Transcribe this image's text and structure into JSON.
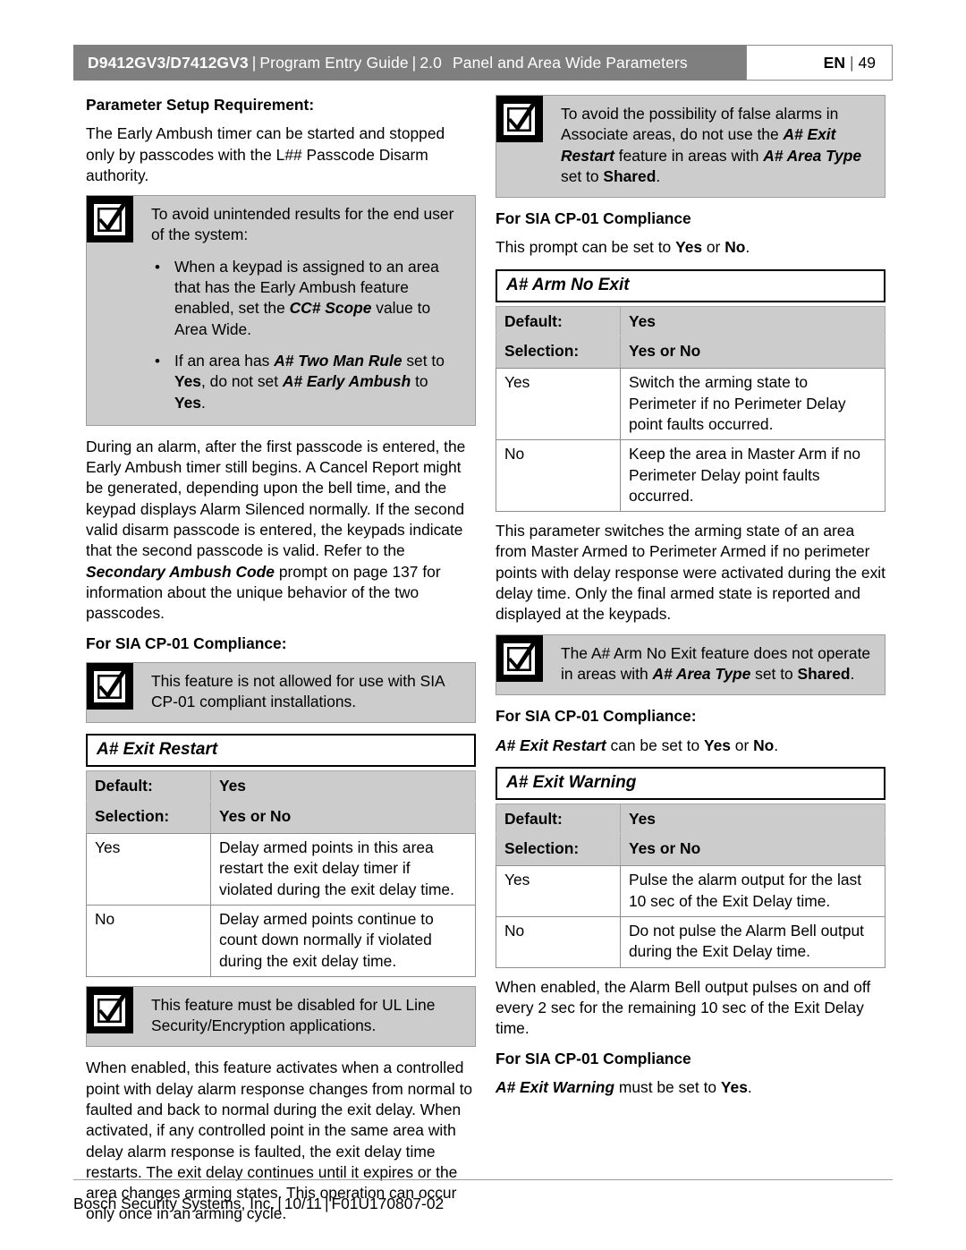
{
  "header": {
    "model": "D9412GV3/D7412GV3",
    "guide": "Program Entry Guide",
    "version": "2.0",
    "section": "Panel and Area Wide Parameters",
    "lang": "EN",
    "page_number": "49",
    "separator": "|"
  },
  "left_column": {
    "setup_heading": "Parameter Setup Requirement:",
    "setup_paragraph": "The Early Ambush timer can be started and stopped only by passcodes with the L## Passcode Disarm authority.",
    "notice_1": {
      "icon": "notice-checkbox-icon",
      "intro": "To avoid unintended results for the end user of the system:",
      "bullets": [
        {
          "part1": "When a keypad is assigned to an area that has the Early Ambush feature enabled, set the ",
          "em1": "CC# Scope",
          "part2": " value to Area Wide."
        },
        {
          "part1": "If an area has ",
          "em1": "A# Two Man Rule",
          "part2": " set to ",
          "b1": "Yes",
          "part3": ", do not set ",
          "em2": "A# Early Ambush",
          "part4": " to ",
          "b2": "Yes",
          "part5": "."
        }
      ]
    },
    "alarm_paragraph_1": "During an alarm, after the first passcode is entered, the Early Ambush timer still begins. A Cancel Report might be generated, depending upon the bell time, and the keypad displays Alarm Silenced normally. If the second valid disarm passcode is entered, the keypads indicate that the second passcode is valid. Refer to the ",
    "alarm_paragraph_em": "Secondary Ambush Code",
    "alarm_paragraph_2": " prompt on page 137 for information about the unique behavior of the two passcodes.",
    "sia_heading": "For SIA CP-01 Compliance:",
    "notice_2": {
      "icon": "notice-checkbox-icon",
      "text": "This feature is not allowed for use with SIA CP-01 compliant installations."
    },
    "param_exit_restart": {
      "title": "A# Exit Restart",
      "default_label": "Default:",
      "default_value": "Yes",
      "selection_label": "Selection:",
      "selection_value": "Yes or No",
      "rows": [
        {
          "key": "Yes",
          "value": "Delay armed points in this area restart the exit delay timer if violated during the exit delay time."
        },
        {
          "key": "No",
          "value": "Delay armed points continue to count down normally if violated during the exit delay time."
        }
      ]
    },
    "notice_3": {
      "icon": "notice-checkbox-icon",
      "text": "This feature must be disabled for UL Line Security/Encryption applications."
    },
    "closing_paragraph": "When enabled, this feature activates when a controlled point with delay alarm response changes from normal to faulted and back to normal during the exit delay. When activated, if any controlled point in the same area with delay alarm response is faulted, the exit delay time restarts. The exit delay continues until it expires or the area changes arming states. This operation can occur only once in an arming cycle."
  },
  "right_column": {
    "notice_1": {
      "icon": "notice-checkbox-icon",
      "part1": "To avoid the possibility of false alarms in Associate areas, do not use the ",
      "em1": "A# Exit Restart",
      "part2": " feature in areas with ",
      "em2": "A# Area Type",
      "part3": " set to ",
      "b1": "Shared",
      "part4": "."
    },
    "sia_heading_1": "For SIA CP-01 Compliance",
    "sia_text_1_part1": "This prompt can be set to ",
    "sia_text_1_b1": "Yes",
    "sia_text_1_part2": " or ",
    "sia_text_1_b2": "No",
    "sia_text_1_part3": ".",
    "param_arm_no_exit": {
      "title": "A# Arm No Exit",
      "default_label": "Default:",
      "default_value": "Yes",
      "selection_label": "Selection:",
      "selection_value": "Yes or No",
      "rows": [
        {
          "key": "Yes",
          "value": "Switch the arming state to Perimeter if no Perimeter Delay point faults occurred."
        },
        {
          "key": "No",
          "value": "Keep the area in Master Arm if no Perimeter Delay point faults occurred."
        }
      ]
    },
    "arm_no_exit_paragraph": "This parameter switches the arming state of an area from Master Armed to Perimeter Armed if no perimeter points with delay response were activated during the exit delay time. Only the final armed state is  reported and displayed at the keypads.",
    "notice_2": {
      "icon": "notice-checkbox-icon",
      "part1": "The A# Arm No Exit feature does not operate in areas with ",
      "em1": "A# Area Type",
      "part2": " set to ",
      "b1": "Shared",
      "part3": "."
    },
    "sia_heading_2": "For SIA CP-01 Compliance:",
    "sia_text_2_em": "A# Exit Restart",
    "sia_text_2_part1": " can be set to ",
    "sia_text_2_b1": "Yes",
    "sia_text_2_part2": " or ",
    "sia_text_2_b2": "No",
    "sia_text_2_part3": ".",
    "param_exit_warning": {
      "title": "A# Exit Warning",
      "default_label": "Default:",
      "default_value": "Yes",
      "selection_label": "Selection:",
      "selection_value": "Yes or No",
      "rows": [
        {
          "key": "Yes",
          "value": "Pulse the alarm output for the last 10 sec of the Exit Delay time."
        },
        {
          "key": "No",
          "value": "Do not pulse the Alarm Bell output during the Exit Delay time."
        }
      ]
    },
    "exit_warning_paragraph": "When enabled, the Alarm Bell output pulses on and off every 2 sec for the remaining 10 sec of the Exit Delay time.",
    "sia_heading_3": "For SIA CP-01 Compliance",
    "sia_text_3_em": "A# Exit Warning",
    "sia_text_3_part1": " must be set to ",
    "sia_text_3_b1": "Yes",
    "sia_text_3_part2": "."
  },
  "footer": {
    "company": "Bosch Security Systems, Inc.",
    "date": "10/11",
    "doc_id": "F01U170807-02",
    "separator": "|"
  },
  "colors": {
    "header_bar": "#7f7f7f",
    "notice_bg": "#cccccc",
    "table_header_bg": "#cccccc",
    "border": "#8d8d8d"
  }
}
